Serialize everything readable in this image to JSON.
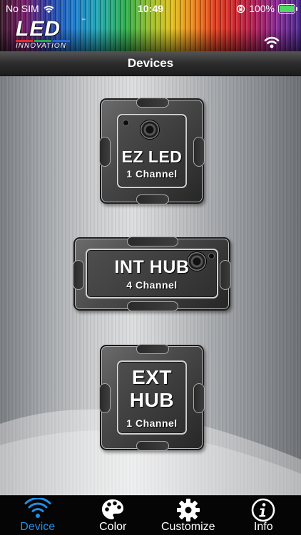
{
  "status": {
    "carrier": "No SIM",
    "time": "10:49",
    "battery": "100%"
  },
  "app": {
    "logo_main": "LED",
    "logo_sub": "INNOVATION",
    "logo_tm": "™"
  },
  "titlebar": {
    "title": "Devices"
  },
  "devices": [
    {
      "name_lines": [
        "EZ LED"
      ],
      "channels": "1 Channel"
    },
    {
      "name_lines": [
        "INT HUB"
      ],
      "channels": "4 Channel"
    },
    {
      "name_lines": [
        "EXT",
        "HUB"
      ],
      "channels": "1 Channel"
    }
  ],
  "tabs": [
    {
      "label": "Device",
      "icon": "wifi-icon",
      "active": true
    },
    {
      "label": "Color",
      "icon": "palette-icon",
      "active": false
    },
    {
      "label": "Customize",
      "icon": "gear-icon",
      "active": false
    },
    {
      "label": "Info",
      "icon": "info-icon",
      "active": false
    }
  ],
  "colors": {
    "active_tab": "#1e8fe6",
    "tab_bar_bg": "#050505",
    "battery_fill": "#4cd964"
  }
}
